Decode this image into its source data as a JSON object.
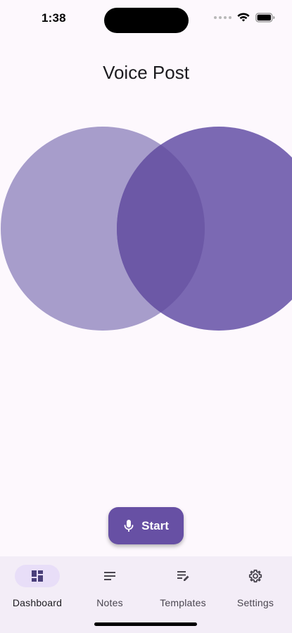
{
  "status_bar": {
    "time": "1:38"
  },
  "header": {
    "title": "Voice Post"
  },
  "visual": {
    "left_circle_color": "#a79dcb",
    "right_circle_color": "#7b69b3",
    "overlap_color": "#6c58a6"
  },
  "action": {
    "start_label": "Start",
    "start_icon": "mic-icon",
    "accent_color": "#6750a4"
  },
  "nav": {
    "items": [
      {
        "label": "Dashboard",
        "icon": "dashboard-icon",
        "active": true
      },
      {
        "label": "Notes",
        "icon": "notes-icon",
        "active": false
      },
      {
        "label": "Templates",
        "icon": "templates-icon",
        "active": false
      },
      {
        "label": "Settings",
        "icon": "settings-icon",
        "active": false
      }
    ]
  }
}
